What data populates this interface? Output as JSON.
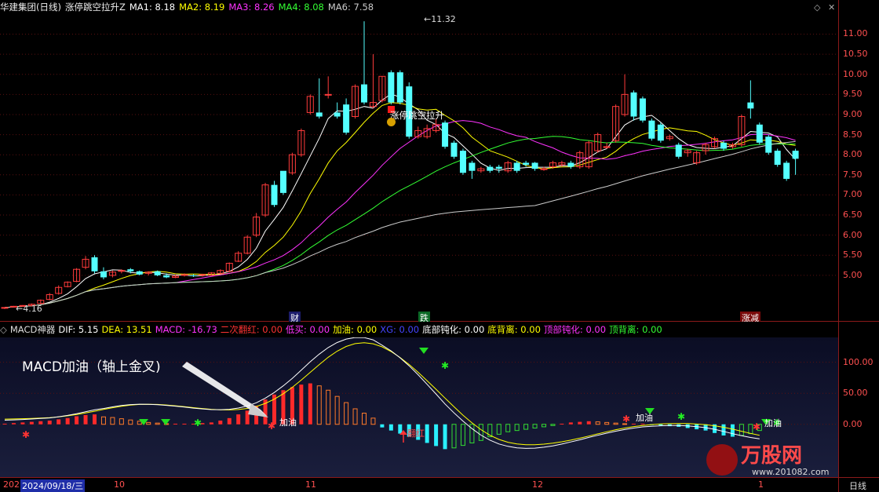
{
  "header": {
    "stock_name": "华建集团(日线)",
    "formula": "涨停跳空拉升Z",
    "ma": [
      {
        "label": "MA1: 8.18",
        "color": "#ffffff"
      },
      {
        "label": "MA2: 8.19",
        "color": "#ffff00"
      },
      {
        "label": "MA3: 8.26",
        "color": "#ff33ff"
      },
      {
        "label": "MA4: 8.08",
        "color": "#33ff33"
      },
      {
        "label": "MA6: 7.58",
        "color": "#cccccc"
      }
    ]
  },
  "price_axis": [
    "11.00",
    "10.50",
    "10.00",
    "9.50",
    "9.00",
    "8.50",
    "8.00",
    "7.50",
    "7.00",
    "6.50",
    "6.00",
    "5.50",
    "5.00"
  ],
  "annotations": {
    "high": "11.32",
    "low": "4.16",
    "signal": "涨停跳空拉升Z",
    "signal_visible": "涨停跳空拉升",
    "cai": "财",
    "die": "跌",
    "zhangjian": "涨减"
  },
  "macd_header": {
    "name": "MACD神器",
    "items": [
      {
        "label": "DIF: 5.15",
        "color": "#ffffff"
      },
      {
        "label": "DEA: 13.51",
        "color": "#ffff00"
      },
      {
        "label": "MACD: -16.73",
        "color": "#ff33ff"
      },
      {
        "label": "二次翻红: 0.00",
        "color": "#ff3333"
      },
      {
        "label": "低买: 0.00",
        "color": "#ff33ff"
      },
      {
        "label": "加油: 0.00",
        "color": "#ffff00"
      },
      {
        "label": "XG: 0.00",
        "color": "#3333ff"
      },
      {
        "label": "底部钝化: 0.00",
        "color": "#ffffff"
      },
      {
        "label": "底背离: 0.00",
        "color": "#ffff00"
      },
      {
        "label": "顶部钝化: 0.00",
        "color": "#ff33ff"
      },
      {
        "label": "顶背离: 0.00",
        "color": "#33ff33"
      }
    ]
  },
  "macd_axis": [
    "100.00",
    "50.00",
    "0.00"
  ],
  "macd_annotation": "MACD加油（轴上金叉)",
  "macd_labels": {
    "jiayou1": "加油",
    "jiayou2": "加油",
    "jiayou3": "加油",
    "fanhong": "翻红"
  },
  "dates": {
    "cur": "2024/09/18/三",
    "m10": "10",
    "m11": "11",
    "m12": "12",
    "m1": "1"
  },
  "date_prefix": "202",
  "period": "日线",
  "watermark": {
    "brand": "万股网",
    "url": "www.201082.com"
  },
  "chart_data": {
    "type": "candlestick",
    "ylim": [
      4.1,
      11.4
    ],
    "open": [
      4.19,
      4.22,
      4.24,
      4.25,
      4.3,
      4.4,
      4.55,
      4.72,
      4.85,
      5.2,
      5.45,
      5.1,
      5.0,
      5.1,
      5.15,
      5.1,
      5.05,
      5.1,
      5.0,
      4.95,
      5.0,
      5.0,
      5.0,
      5.0,
      5.05,
      5.1,
      5.35,
      5.55,
      6.0,
      6.5,
      7.25,
      7.6,
      7.55,
      8.0,
      9.05,
      9.05,
      9.5,
      9.05,
      9.25,
      8.95,
      9.75,
      9.2,
      9.35,
      10.05,
      10.05,
      9.7,
      8.45,
      8.45,
      8.6,
      8.8,
      8.3,
      8.1,
      7.8,
      7.6,
      7.7,
      7.7,
      7.6,
      7.8,
      7.8,
      7.8,
      7.65,
      7.7,
      7.75,
      7.8,
      7.7,
      7.7,
      8.1,
      8.2,
      8.35,
      9.0,
      9.55,
      9.4,
      8.85,
      8.75,
      8.4,
      8.25,
      8.05,
      7.8,
      8.1,
      8.2,
      8.3,
      8.2,
      8.25,
      9.3,
      8.75,
      8.45,
      8.1,
      7.8,
      8.1
    ],
    "close": [
      4.2,
      4.23,
      4.25,
      4.28,
      4.38,
      4.52,
      4.7,
      4.83,
      5.15,
      5.4,
      5.1,
      4.95,
      5.08,
      5.12,
      5.1,
      5.02,
      5.08,
      5.0,
      4.95,
      4.98,
      5.02,
      4.98,
      5.02,
      5.06,
      5.12,
      5.3,
      5.55,
      5.95,
      6.45,
      7.25,
      6.75,
      7.05,
      8.0,
      8.6,
      9.45,
      8.95,
      9.5,
      8.95,
      8.55,
      9.7,
      9.3,
      9.3,
      9.95,
      9.3,
      9.3,
      8.45,
      8.6,
      8.65,
      8.75,
      8.2,
      7.95,
      7.55,
      7.6,
      7.65,
      7.6,
      7.65,
      7.8,
      7.6,
      7.75,
      7.65,
      7.65,
      7.8,
      7.8,
      7.7,
      8.05,
      8.3,
      8.5,
      8.2,
      9.2,
      9.5,
      8.95,
      8.85,
      8.4,
      8.35,
      8.45,
      7.95,
      8.1,
      8.05,
      8.25,
      8.4,
      8.15,
      8.25,
      8.95,
      9.15,
      8.3,
      8.05,
      7.75,
      7.4,
      7.9
    ],
    "high": [
      4.21,
      4.24,
      4.26,
      4.3,
      4.4,
      4.56,
      4.75,
      4.85,
      5.18,
      5.48,
      5.5,
      5.2,
      5.12,
      5.15,
      5.18,
      5.12,
      5.1,
      5.12,
      5.05,
      5.02,
      5.05,
      5.03,
      5.04,
      5.08,
      5.15,
      5.32,
      5.6,
      6.0,
      6.55,
      7.3,
      7.35,
      7.35,
      8.05,
      8.65,
      9.5,
      9.9,
      9.95,
      9.3,
      9.4,
      9.75,
      11.32,
      10.5,
      9.95,
      10.1,
      10.1,
      9.8,
      8.7,
      8.75,
      8.9,
      8.85,
      8.35,
      8.15,
      7.85,
      7.7,
      7.75,
      7.75,
      7.85,
      7.85,
      7.85,
      7.82,
      7.7,
      7.85,
      7.85,
      7.85,
      8.1,
      8.35,
      8.55,
      8.3,
      9.25,
      10.0,
      9.6,
      9.45,
      8.9,
      8.8,
      8.5,
      8.3,
      8.15,
      8.1,
      8.3,
      8.45,
      8.35,
      8.3,
      9.0,
      9.85,
      8.8,
      8.5,
      8.15,
      7.85,
      8.15
    ],
    "low": [
      4.16,
      4.2,
      4.22,
      4.23,
      4.28,
      4.38,
      4.52,
      4.7,
      4.83,
      5.15,
      5.05,
      4.9,
      4.95,
      5.05,
      5.05,
      5.0,
      5.0,
      4.98,
      4.93,
      4.93,
      4.97,
      4.96,
      4.97,
      5.0,
      5.03,
      5.08,
      5.33,
      5.52,
      5.95,
      6.45,
      6.7,
      7.0,
      7.5,
      7.95,
      9.0,
      8.9,
      9.4,
      8.9,
      8.5,
      8.9,
      9.25,
      9.15,
      9.3,
      9.25,
      9.25,
      8.4,
      8.4,
      8.4,
      8.55,
      8.15,
      7.9,
      7.5,
      7.4,
      7.55,
      7.55,
      7.55,
      7.55,
      7.55,
      7.7,
      7.6,
      7.6,
      7.65,
      7.7,
      7.65,
      7.65,
      7.65,
      8.05,
      8.15,
      8.3,
      8.95,
      8.85,
      8.8,
      8.35,
      8.3,
      8.35,
      7.9,
      7.95,
      7.75,
      8.0,
      8.15,
      8.1,
      8.15,
      8.2,
      8.9,
      8.25,
      8.0,
      7.7,
      7.35,
      7.5
    ],
    "ma_lines": [
      "MA1",
      "MA2",
      "MA3",
      "MA4",
      "MA6"
    ],
    "macd_ylim": [
      -80,
      135
    ],
    "macd_hist": [
      1,
      2,
      3,
      4,
      5,
      6,
      8,
      10,
      13,
      15,
      16,
      12,
      11,
      9,
      7,
      5,
      3,
      2,
      1,
      1,
      1,
      1,
      2,
      3,
      6,
      10,
      16,
      22,
      30,
      40,
      48,
      55,
      60,
      64,
      66,
      62,
      55,
      45,
      35,
      25,
      18,
      10,
      -5,
      -10,
      -15,
      -20,
      -25,
      -30,
      -35,
      -40,
      -38,
      -34,
      -30,
      -26,
      -20,
      -16,
      -12,
      -10,
      -8,
      -6,
      -4,
      -2,
      1,
      3,
      4,
      5,
      4,
      3,
      2,
      1,
      1,
      1,
      -1,
      -2,
      -3,
      -4,
      -6,
      -8,
      -10,
      -14,
      -18,
      -20,
      -18,
      -15,
      -10
    ]
  }
}
